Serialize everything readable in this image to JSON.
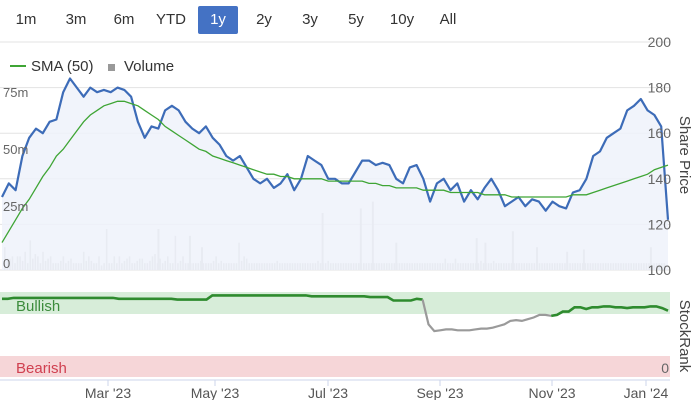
{
  "range_buttons": {
    "active": "1y",
    "items": [
      {
        "label": "1m"
      },
      {
        "label": "3m"
      },
      {
        "label": "6m"
      },
      {
        "label": "YTD"
      },
      {
        "label": "1y"
      },
      {
        "label": "2y"
      },
      {
        "label": "3y"
      },
      {
        "label": "5y"
      },
      {
        "label": "10y"
      },
      {
        "label": "All"
      }
    ]
  },
  "colors": {
    "price_line": "#3d6cb8",
    "price_fill": "#eef2fa",
    "sma_line": "#3fa535",
    "volume_bar": "#c4c4c4",
    "bullish_band": "#d7edd9",
    "bearish_band": "#f6d6d8",
    "stockrank_bullish": "#2e8b2e",
    "stockrank_neutral": "#9a9a9a",
    "active_button": "#4472c4"
  },
  "chart_data": {
    "type": "line",
    "x_tick_labels": [
      "Mar '23",
      "May '23",
      "Jul '23",
      "Sep '23",
      "Nov '23",
      "Jan '24"
    ],
    "legend": {
      "placement": "top-left",
      "entries": [
        {
          "label": "SMA (50)",
          "kind": "line"
        },
        {
          "label": "Volume",
          "kind": "square"
        }
      ]
    },
    "share_price_axis": {
      "label": "Share Price",
      "min": 100,
      "max": 200,
      "ticks": [
        "100",
        "120",
        "140",
        "160",
        "180",
        "200"
      ]
    },
    "volume_axis": {
      "min": 0,
      "max": 100,
      "ticks": [
        {
          "value": 0,
          "label": "0"
        },
        {
          "value": 25,
          "label": "25m"
        },
        {
          "value": 50,
          "label": "50m"
        },
        {
          "value": 75,
          "label": "75m"
        }
      ]
    },
    "price": [
      132,
      138,
      135,
      150,
      158,
      162,
      160,
      165,
      166,
      178,
      184,
      180,
      176,
      180,
      178,
      179,
      178,
      180,
      179,
      176,
      165,
      158,
      163,
      162,
      170,
      172,
      170,
      165,
      162,
      160,
      163,
      158,
      155,
      150,
      148,
      150,
      145,
      140,
      138,
      140,
      136,
      138,
      142,
      135,
      140,
      150,
      148,
      146,
      140,
      140,
      138,
      138,
      143,
      148,
      148,
      146,
      147,
      146,
      140,
      138,
      145,
      146,
      140,
      130,
      138,
      140,
      135,
      138,
      130,
      135,
      131,
      136,
      140,
      135,
      128,
      130,
      132,
      128,
      131,
      130,
      126,
      130,
      128,
      127,
      134,
      135,
      140,
      150,
      152,
      158,
      160,
      162,
      170,
      172,
      175,
      170,
      168,
      163,
      122
    ],
    "sma_50": [
      112,
      117,
      122,
      127,
      131,
      136,
      141,
      145,
      150,
      153,
      157,
      161,
      165,
      168,
      170,
      172,
      173,
      174,
      174,
      173,
      172,
      170,
      168,
      166,
      163,
      161,
      159,
      157,
      155,
      153,
      152,
      150,
      149,
      148,
      147,
      146,
      145,
      144,
      143,
      142,
      142,
      141,
      141,
      140,
      140,
      140,
      140,
      140,
      139,
      139,
      139,
      139,
      139,
      139,
      138,
      138,
      137,
      137,
      136,
      136,
      136,
      136,
      135,
      135,
      135,
      135,
      134,
      134,
      134,
      134,
      134,
      133,
      133,
      133,
      133,
      132,
      132,
      132,
      132,
      132,
      132,
      132,
      132,
      132,
      133,
      133,
      133,
      134,
      135,
      136,
      137,
      138,
      139,
      140,
      141,
      142,
      144,
      145,
      146
    ],
    "volume": [
      10,
      5,
      5,
      6,
      3,
      6,
      6,
      4,
      8,
      3,
      13,
      5,
      7,
      6,
      3,
      8,
      4,
      5,
      6,
      3,
      3,
      3,
      4,
      6,
      3,
      4,
      5,
      3,
      3,
      3,
      3,
      8,
      4,
      6,
      4,
      3,
      3,
      6,
      2,
      3,
      18,
      3,
      3,
      6,
      3,
      6,
      3,
      4,
      5,
      6,
      3,
      3,
      4,
      5,
      5,
      3,
      3,
      4,
      6,
      7,
      3,
      5,
      3,
      4,
      6,
      3,
      3,
      15,
      3,
      4,
      6,
      3,
      3,
      3,
      3,
      3,
      3,
      4,
      3,
      3,
      3,
      3,
      4,
      6,
      3,
      4,
      3,
      3,
      3,
      3,
      3,
      3,
      12,
      4,
      6,
      5,
      3,
      3,
      3,
      3,
      3,
      3,
      3,
      3,
      3,
      3,
      3,
      4,
      3,
      3,
      3,
      3,
      3,
      3,
      3,
      3,
      3,
      3,
      3,
      3,
      3,
      3,
      3,
      4,
      3,
      3,
      3,
      4,
      3,
      3,
      3,
      3,
      3,
      3,
      3,
      3,
      3,
      3,
      3,
      3,
      3,
      3,
      3,
      3,
      3,
      3,
      3,
      3,
      3,
      3,
      3,
      3,
      3,
      3,
      3,
      3,
      3,
      3,
      3,
      3,
      3,
      3,
      3,
      3,
      3,
      3,
      3,
      3,
      3,
      3,
      3,
      3,
      3,
      5,
      3,
      3,
      3,
      5,
      3,
      3,
      3,
      3,
      3,
      3,
      3,
      3,
      3,
      4,
      3,
      3,
      3,
      3,
      4,
      3,
      3,
      3,
      3,
      3,
      3,
      3,
      3,
      3,
      3,
      3,
      3,
      3,
      3,
      3,
      3,
      3,
      3,
      3,
      3,
      3,
      3,
      3,
      3,
      3,
      3,
      3,
      3,
      3,
      3,
      3,
      3,
      3,
      3,
      3,
      3,
      3,
      3,
      3,
      3,
      3,
      3,
      3,
      3,
      3,
      3,
      3,
      3,
      3,
      3,
      3,
      3,
      3,
      3,
      3,
      3,
      3,
      3,
      3,
      3,
      3,
      3,
      3,
      3,
      3,
      3,
      3
    ],
    "volume_spikes": [
      {
        "x": 0.235,
        "value": 18
      },
      {
        "x": 0.282,
        "value": 15
      },
      {
        "x": 0.3,
        "value": 10
      },
      {
        "x": 0.48,
        "value": 25
      },
      {
        "x": 0.537,
        "value": 27
      },
      {
        "x": 0.555,
        "value": 30
      },
      {
        "x": 0.59,
        "value": 12
      },
      {
        "x": 0.71,
        "value": 14
      },
      {
        "x": 0.723,
        "value": 12
      },
      {
        "x": 0.764,
        "value": 17
      },
      {
        "x": 0.8,
        "value": 10
      },
      {
        "x": 0.845,
        "value": 8
      },
      {
        "x": 0.87,
        "value": 9
      },
      {
        "x": 0.97,
        "value": 10
      }
    ],
    "stockrank": {
      "label": "StockRank",
      "bands": [
        {
          "label": "Bullish"
        },
        {
          "label": "Bearish"
        }
      ],
      "ticks": [
        "0"
      ],
      "values": [
        92,
        92,
        93,
        93,
        93,
        93,
        93,
        93,
        93,
        93,
        93,
        93,
        93,
        93,
        93,
        93,
        93,
        93,
        93,
        93,
        92,
        92,
        92,
        92,
        92,
        92,
        92,
        92,
        92,
        92,
        91,
        91,
        91,
        91,
        91,
        91,
        96,
        96,
        96,
        96,
        96,
        96,
        96,
        96,
        96,
        96,
        96,
        96,
        96,
        96,
        96,
        96,
        96,
        95,
        95,
        95,
        95,
        95,
        95,
        95,
        95,
        95,
        95,
        94,
        94,
        94,
        94,
        90,
        90,
        90,
        90,
        92,
        91,
        62,
        54,
        55,
        56,
        56,
        55,
        55,
        55,
        56,
        57,
        57,
        58,
        60,
        62,
        66,
        67,
        66,
        68,
        70,
        73,
        73,
        72,
        73,
        77,
        77,
        82,
        82,
        80,
        82,
        82,
        83,
        83,
        82,
        82,
        81,
        82,
        82,
        82,
        83,
        83,
        81,
        78
      ],
      "bullish_until_index": 72
    }
  }
}
